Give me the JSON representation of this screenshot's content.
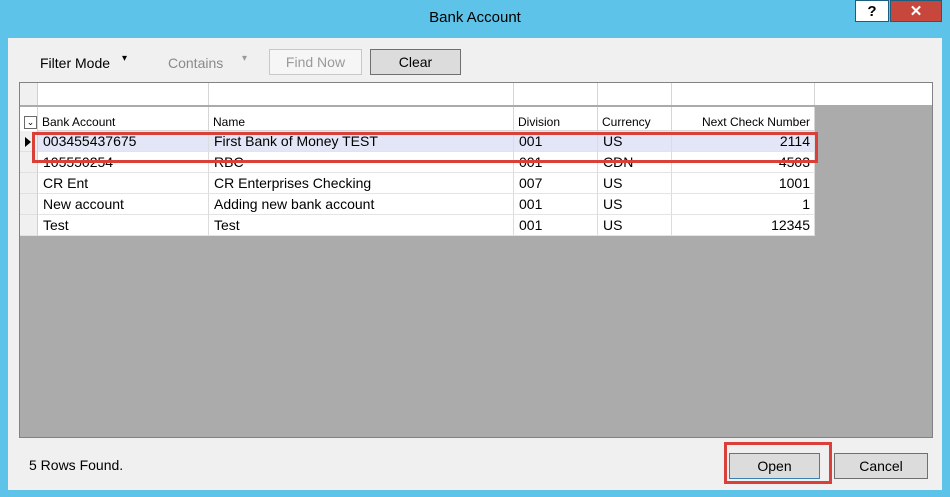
{
  "window": {
    "title": "Bank Account",
    "help_label": "?",
    "close_label": "✕"
  },
  "toolbar": {
    "filter_mode": "Filter Mode",
    "filter_mode_arrow": "▾",
    "contains": "Contains",
    "contains_arrow": "▾",
    "find_now": "Find Now",
    "clear": "Clear"
  },
  "grid": {
    "columns": [
      "Bank Account",
      "Name",
      "Division",
      "Currency",
      "Next Check Number"
    ],
    "rows": [
      [
        "003455437675",
        "First Bank of Money TEST",
        "001",
        "US",
        "2114"
      ],
      [
        "105550254",
        "RBC",
        "001",
        "CDN",
        "4503"
      ],
      [
        "CR Ent",
        "CR Enterprises Checking",
        "007",
        "US",
        "1001"
      ],
      [
        "New account",
        "Adding new bank account",
        "001",
        "US",
        "1"
      ],
      [
        "Test",
        "Test",
        "001",
        "US",
        "12345"
      ]
    ],
    "selected_row": 0
  },
  "status": {
    "rows_found": "5 Rows Found."
  },
  "buttons": {
    "open": "Open",
    "cancel": "Cancel"
  },
  "colors": {
    "title_bar": "#5ec3e9",
    "close_button": "#c7473c",
    "highlight": "#d9403a",
    "selected_row": "#e2e6f6"
  }
}
